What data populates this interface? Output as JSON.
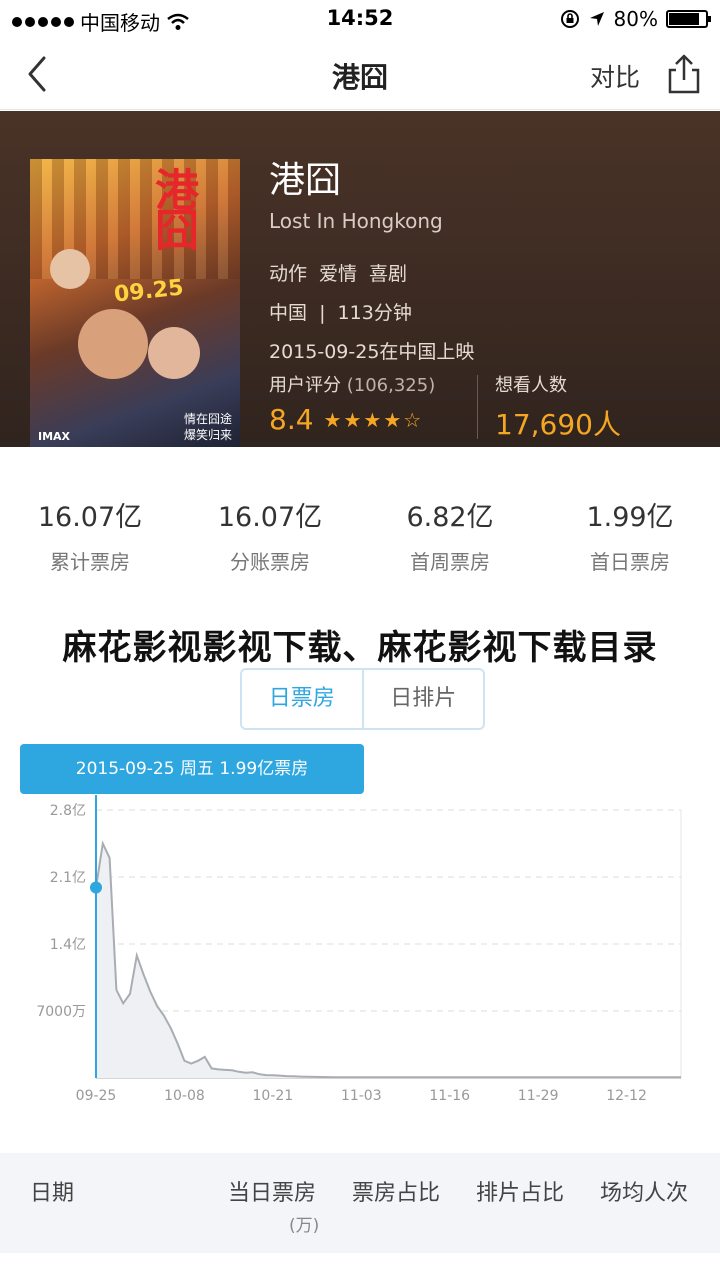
{
  "status_bar": {
    "carrier": "中国移动",
    "time": "14:52",
    "battery": "80%",
    "battery_level": 0.8
  },
  "nav": {
    "title": "港囧",
    "compare_label": "对比"
  },
  "movie": {
    "cn_name": "港囧",
    "en_name": "Lost In Hongkong",
    "genres": [
      "动作",
      "爱情",
      "喜剧"
    ],
    "meta": "中国  |  113分钟",
    "release": "2015-09-25在中国上映",
    "poster": {
      "title": "港囧",
      "date": "09.25",
      "imax": "IMAX",
      "tagline_1": "情在囧途",
      "tagline_2": "爆笑归来"
    },
    "rating_label": "用户评分",
    "rating_count": "(106,325)",
    "rating": "8.4",
    "stars": 4.5,
    "want_label": "想看人数",
    "want_count": "17,690人"
  },
  "stats": [
    {
      "value": "16.07亿",
      "label": "累计票房"
    },
    {
      "value": "16.07亿",
      "label": "分账票房"
    },
    {
      "value": "6.82亿",
      "label": "首周票房"
    },
    {
      "value": "1.99亿",
      "label": "首日票房"
    }
  ],
  "overlay_text": "麻花影视影视下载、麻花影视下载目录",
  "tabs": [
    {
      "label": "日票房",
      "active": true
    },
    {
      "label": "日排片",
      "active": false
    }
  ],
  "chart_tooltip": "2015-09-25 周五 1.99亿票房",
  "chart_data": {
    "type": "area",
    "title": "",
    "xlabel": "",
    "ylabel": "",
    "ylim": [
      0,
      28000
    ],
    "y_unit": "万",
    "y_ticks": [
      {
        "value": 7000,
        "label": "7000万"
      },
      {
        "value": 14000,
        "label": "1.4亿"
      },
      {
        "value": 21000,
        "label": "2.1亿"
      },
      {
        "value": 28000,
        "label": "2.8亿"
      }
    ],
    "x_ticks": [
      "09-25",
      "10-08",
      "10-21",
      "11-03",
      "11-16",
      "11-29",
      "12-12"
    ],
    "x_tick_day_index": [
      0,
      13,
      26,
      39,
      52,
      65,
      78
    ],
    "x_range_days": [
      0,
      86
    ],
    "series": [
      {
        "day_index": [
          0,
          1,
          2,
          3,
          4,
          5,
          6,
          7,
          8,
          9,
          10,
          11,
          12,
          13,
          14,
          15,
          16,
          17,
          18,
          19,
          20,
          21,
          22,
          23,
          24,
          25,
          26,
          27,
          28,
          29,
          30,
          31,
          32,
          33,
          34,
          35
        ],
        "values": [
          19900,
          24500,
          23000,
          9200,
          7800,
          8800,
          12800,
          10800,
          9000,
          7500,
          6500,
          5200,
          3600,
          1800,
          1500,
          1800,
          2200,
          1000,
          900,
          850,
          800,
          650,
          550,
          600,
          400,
          300,
          280,
          250,
          200,
          180,
          150,
          130,
          110,
          100,
          90,
          80
        ],
        "highlight_index": 0
      }
    ],
    "grid": true,
    "legend": "none"
  },
  "table_header": {
    "date": "日期",
    "daily_box": "当日票房",
    "daily_box_unit": "(万)",
    "box_share": "票房占比",
    "screen_share": "排片占比",
    "avg_per_show": "场均人次"
  }
}
